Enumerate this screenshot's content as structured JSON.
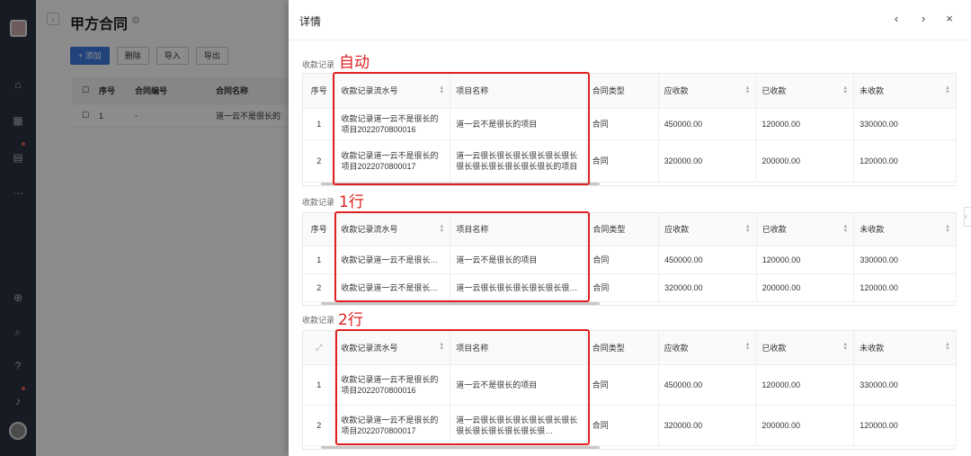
{
  "background": {
    "title": "甲方合同",
    "toolbar": [
      "+ 添加",
      "删除",
      "导入",
      "导出"
    ],
    "columns": [
      "序号",
      "合同编号",
      "合同名称"
    ],
    "row": [
      "1",
      "-",
      "道一云不是很长的"
    ]
  },
  "drawer": {
    "title": "详情",
    "prev_icon": "‹",
    "next_icon": "›",
    "close_icon": "×"
  },
  "sections": [
    {
      "label": "收款记录",
      "annotation": "自动",
      "columns": [
        "序号",
        "收款记录流水号",
        "项目名称",
        "合同类型",
        "应收款",
        "已收款",
        "未收款"
      ],
      "rows": [
        [
          "1",
          "收款记录道一云不是很长的项目2022070800016",
          "道一云不是很长的项目",
          "合同",
          "450000.00",
          "120000.00",
          "330000.00"
        ],
        [
          "2",
          "收款记录道一云不是很长的项目2022070800017",
          "道一云很长很长很长很长很长很长很长很长很长很长很长很长的项目",
          "合同",
          "320000.00",
          "200000.00",
          "120000.00"
        ]
      ]
    },
    {
      "label": "收款记录",
      "annotation": "1行",
      "columns": [
        "序号",
        "收款记录流水号",
        "项目名称",
        "合同类型",
        "应收款",
        "已收款",
        "未收款"
      ],
      "rows": [
        [
          "1",
          "收款记录道一云不是很长…",
          "道一云不是很长的项目",
          "合同",
          "450000.00",
          "120000.00",
          "330000.00"
        ],
        [
          "2",
          "收款记录道一云不是很长…",
          "道一云很长很长很长很长很长很…",
          "合同",
          "320000.00",
          "200000.00",
          "120000.00"
        ]
      ]
    },
    {
      "label": "收款记录",
      "annotation": "2行",
      "columns": [
        "",
        "收款记录流水号",
        "项目名称",
        "合同类型",
        "应收款",
        "已收款",
        "未收款"
      ],
      "rows": [
        [
          "1",
          "收款记录道一云不是很长的项目2022070800016",
          "道一云不是很长的项目",
          "合同",
          "450000.00",
          "120000.00",
          "330000.00"
        ],
        [
          "2",
          "收款记录道一云不是很长的项目2022070800017",
          "道一云很长很长很长很长很长很长很长很长很长很长很长很…",
          "合同",
          "320000.00",
          "200000.00",
          "120000.00"
        ]
      ]
    }
  ]
}
